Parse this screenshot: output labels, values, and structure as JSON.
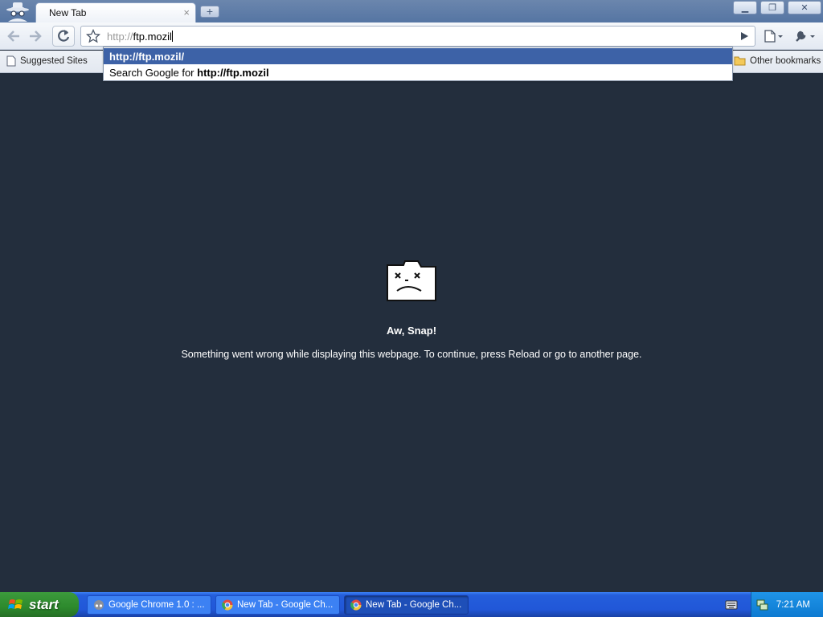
{
  "browser": {
    "tab_title": "New Tab",
    "tab_close": "×",
    "new_tab": "+",
    "window_buttons": {
      "minimize": "▁",
      "restore": "❐",
      "close": "✕"
    }
  },
  "omnibox": {
    "scheme": "http://",
    "text": "ftp.mozil"
  },
  "autocomplete": {
    "suggestion_url": "http://ftp.mozil/",
    "search_prefix": "Search Google for ",
    "search_term": "http://ftp.mozil"
  },
  "bookmarks": {
    "suggested_sites": "Suggested Sites",
    "other_bookmarks": "Other bookmarks"
  },
  "error": {
    "title": "Aw, Snap!",
    "message": "Something went wrong while displaying this webpage. To continue, press Reload or go to another page."
  },
  "taskbar": {
    "start_label": "start",
    "tasks": [
      {
        "label": "Google Chrome 1.0 : ..."
      },
      {
        "label": "New Tab - Google Ch..."
      },
      {
        "label": "New Tab - Google Ch..."
      }
    ],
    "clock": "7:21 AM"
  },
  "colors": {
    "content_background": "#232e3d",
    "selection": "#3d62a7",
    "taskbar": "#245edb"
  }
}
